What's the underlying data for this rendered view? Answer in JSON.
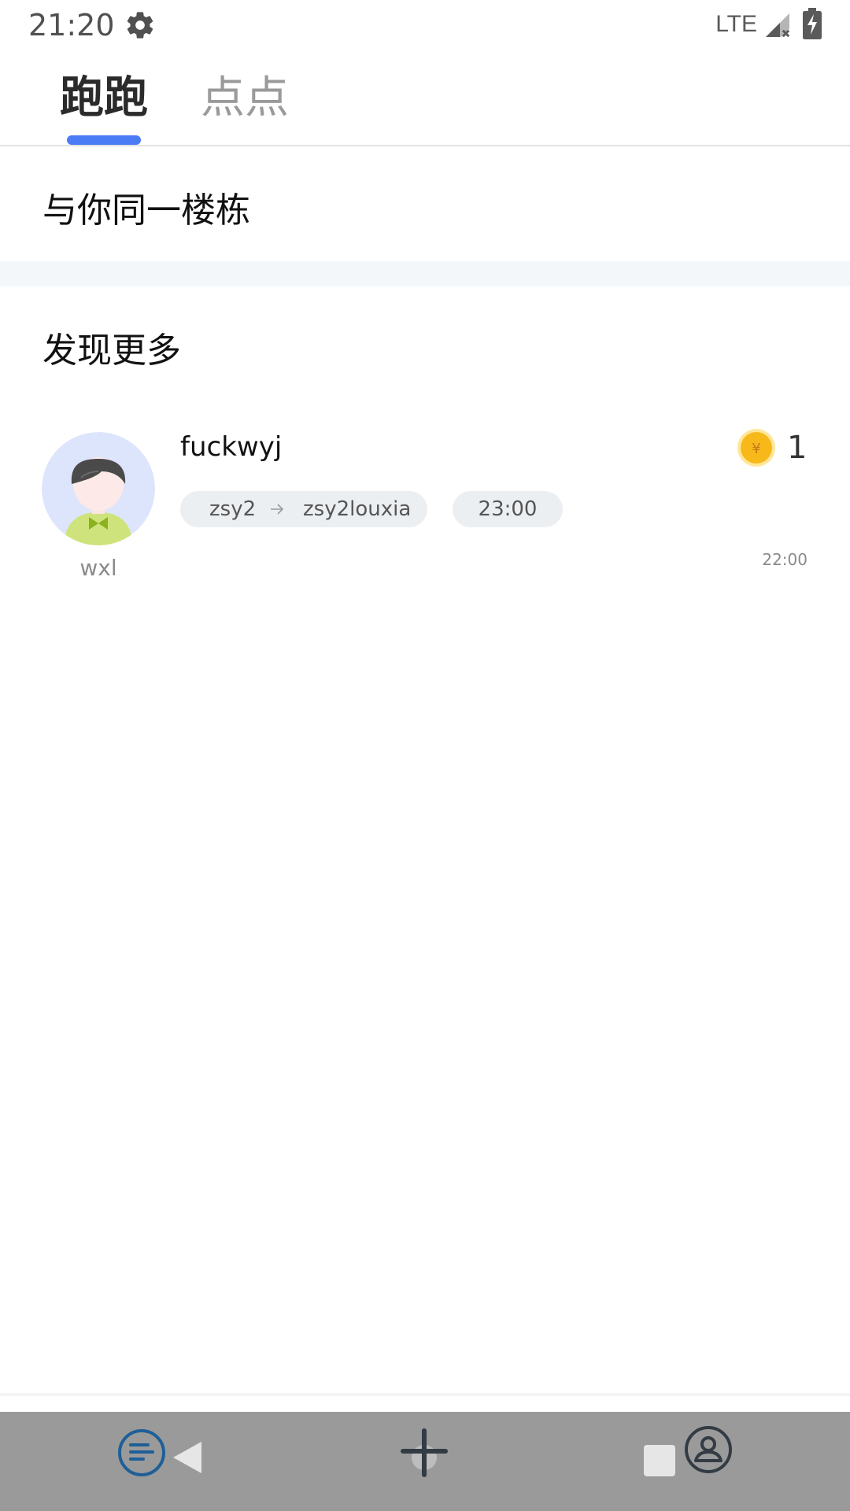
{
  "status_bar": {
    "time": "21:20",
    "network": "LTE",
    "icons": [
      "gear-icon",
      "signal-icon",
      "battery-charging-icon"
    ]
  },
  "tabs": [
    {
      "label": "跑跑",
      "active": true
    },
    {
      "label": "点点",
      "active": false
    }
  ],
  "sections": {
    "same_building": {
      "title": "与你同一楼栋"
    },
    "discover": {
      "title": "发现更多"
    }
  },
  "card": {
    "avatar_name": "wxl",
    "name": "fuckwyj",
    "coin_amount": "1",
    "route_from": "zsy2",
    "route_to": "zsy2louxia",
    "deadline": "23:00",
    "post_time": "22:00",
    "icons": [
      "avatar-icon",
      "coin-icon",
      "arrow-right-icon"
    ]
  },
  "nav_bar": {
    "icons": [
      "list-icon",
      "back-icon",
      "plus-icon",
      "recents-icon",
      "profile-icon"
    ]
  },
  "colors": {
    "accent": "#4b7bf5",
    "nav_bg": "#9a9a9a",
    "chip_bg": "#eceff2",
    "coin": "#f7b81a",
    "nav_icon_blue": "#1f5f98"
  }
}
